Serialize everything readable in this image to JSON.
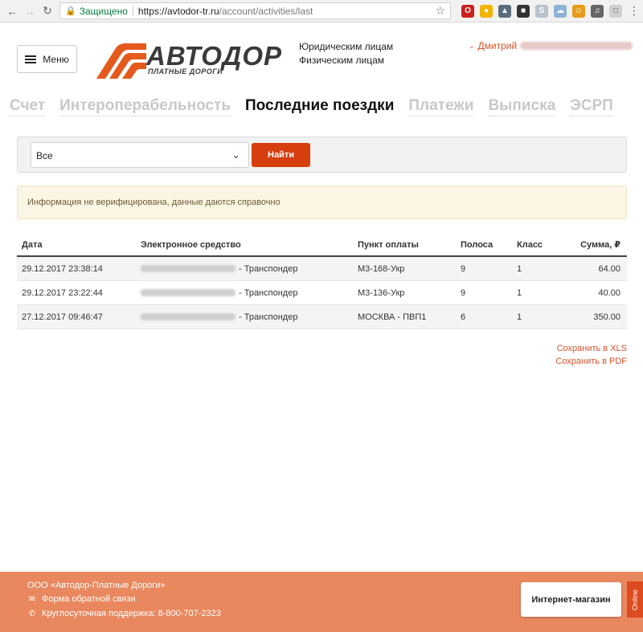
{
  "browser": {
    "secure_label": "Защищено",
    "url_host": "https://avtodor-tr.ru",
    "url_path": "/account/activities/last"
  },
  "header": {
    "menu_label": "Меню",
    "logo_name": "АВТОДОР",
    "logo_sub": "ПЛАТНЫЕ ДОРОГИ",
    "link_legal": "Юридическим лицам",
    "link_personal": "Физическим лицам",
    "user_name": "Дмитрий"
  },
  "tabs": [
    {
      "label": "Счет",
      "active": false
    },
    {
      "label": "Интероперабельность",
      "active": false
    },
    {
      "label": "Последние поездки",
      "active": true
    },
    {
      "label": "Платежи",
      "active": false
    },
    {
      "label": "Выписка",
      "active": false
    },
    {
      "label": "ЭСРП",
      "active": false
    }
  ],
  "filter": {
    "select_value": "Все",
    "button_label": "Найти"
  },
  "notice": "Информация не верифицирована, данные даются справочно",
  "table": {
    "headers": {
      "date": "Дата",
      "device": "Электронное средство",
      "point": "Пункт оплаты",
      "lane": "Полоса",
      "class": "Класс",
      "sum": "Сумма, ₽"
    },
    "rows": [
      {
        "date": "29.12.2017 23:38:14",
        "device": "- Транспондер",
        "point": "М3-168-Укр",
        "lane": "9",
        "class": "1",
        "sum": "64.00"
      },
      {
        "date": "29.12.2017 23:22:44",
        "device": "- Транспондер",
        "point": "М3-136-Укр",
        "lane": "9",
        "class": "1",
        "sum": "40.00"
      },
      {
        "date": "27.12.2017 09:46:47",
        "device": "- Транспондер",
        "point": "МОСКВА - ПВП1",
        "lane": "6",
        "class": "1",
        "sum": "350.00"
      }
    ]
  },
  "save": {
    "xls": "Сохранить в XLS",
    "pdf": "Сохранить в PDF"
  },
  "footer": {
    "company": "ООО «Автодор-Платные Дороги»",
    "feedback": "Форма обратной связи",
    "support": "Круглосуточная поддержка: 8-800-707-2323",
    "shop_button": "Интернет-магазин",
    "online_label": "Online"
  },
  "colors": {
    "accent": "#d63e0e",
    "link": "#d8522b",
    "footer_bg": "#e9885f"
  }
}
